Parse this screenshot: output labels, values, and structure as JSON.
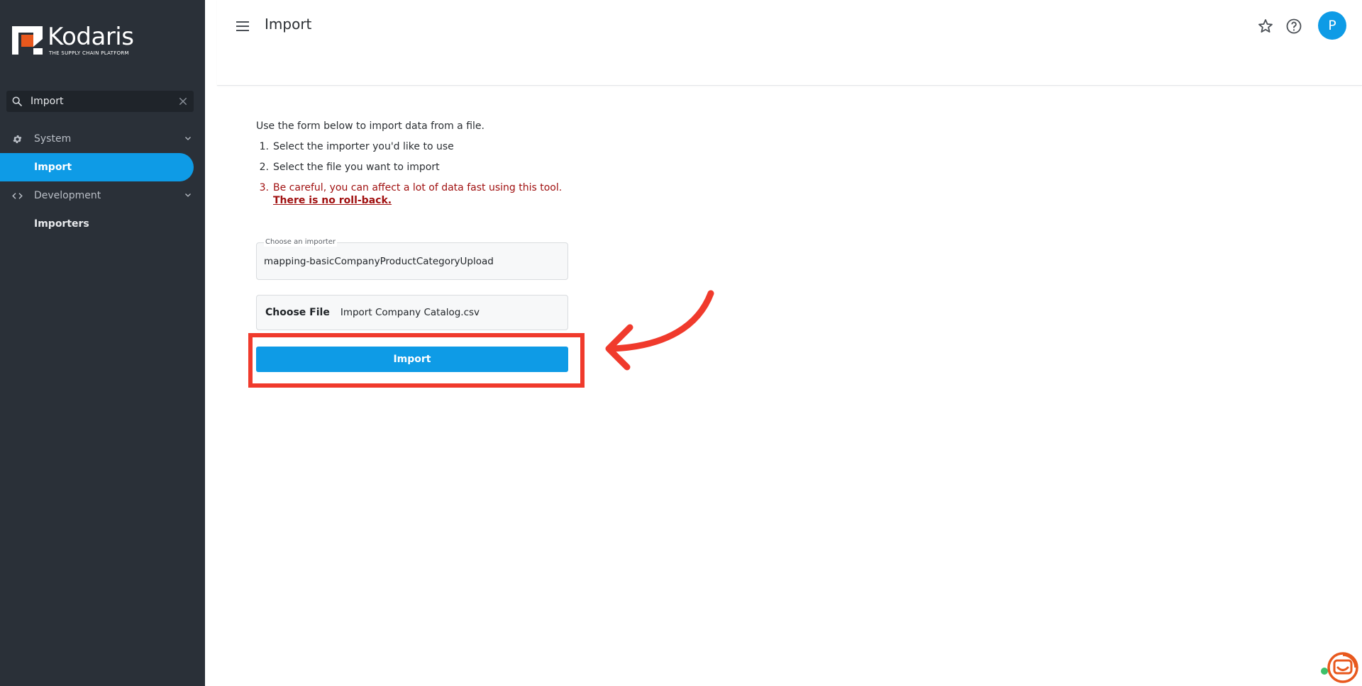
{
  "brand": {
    "name": "Kodaris",
    "tagline": "THE SUPPLY CHAIN PLATFORM",
    "accent_color": "#0e9be6",
    "logo_color": "#e8581d"
  },
  "sidebar": {
    "search": {
      "value": "Import"
    },
    "groups": [
      {
        "label": "System",
        "icon": "gear-icon",
        "items": [
          {
            "label": "Import",
            "active": true
          }
        ]
      },
      {
        "label": "Development",
        "icon": "code-icon",
        "items": [
          {
            "label": "Importers",
            "active": false
          }
        ]
      }
    ]
  },
  "header": {
    "title": "Import",
    "avatar_initial": "P"
  },
  "main": {
    "intro": "Use the form below to import data from a file.",
    "steps": [
      {
        "num": "1.",
        "text": "Select the importer you'd like to use"
      },
      {
        "num": "2.",
        "text": "Select the file you want to import"
      },
      {
        "num": "3.",
        "text": "Be careful, you can affect a lot of data fast using this tool.",
        "emphasis": "There is no roll-back."
      }
    ],
    "importer_field": {
      "label": "Choose an importer",
      "value": "mapping-basicCompanyProductCategoryUpload"
    },
    "file_field": {
      "button": "Choose File",
      "file_name": "Import Company Catalog.csv"
    },
    "import_button": "Import"
  },
  "annotation": {
    "color": "#f03a2c"
  }
}
